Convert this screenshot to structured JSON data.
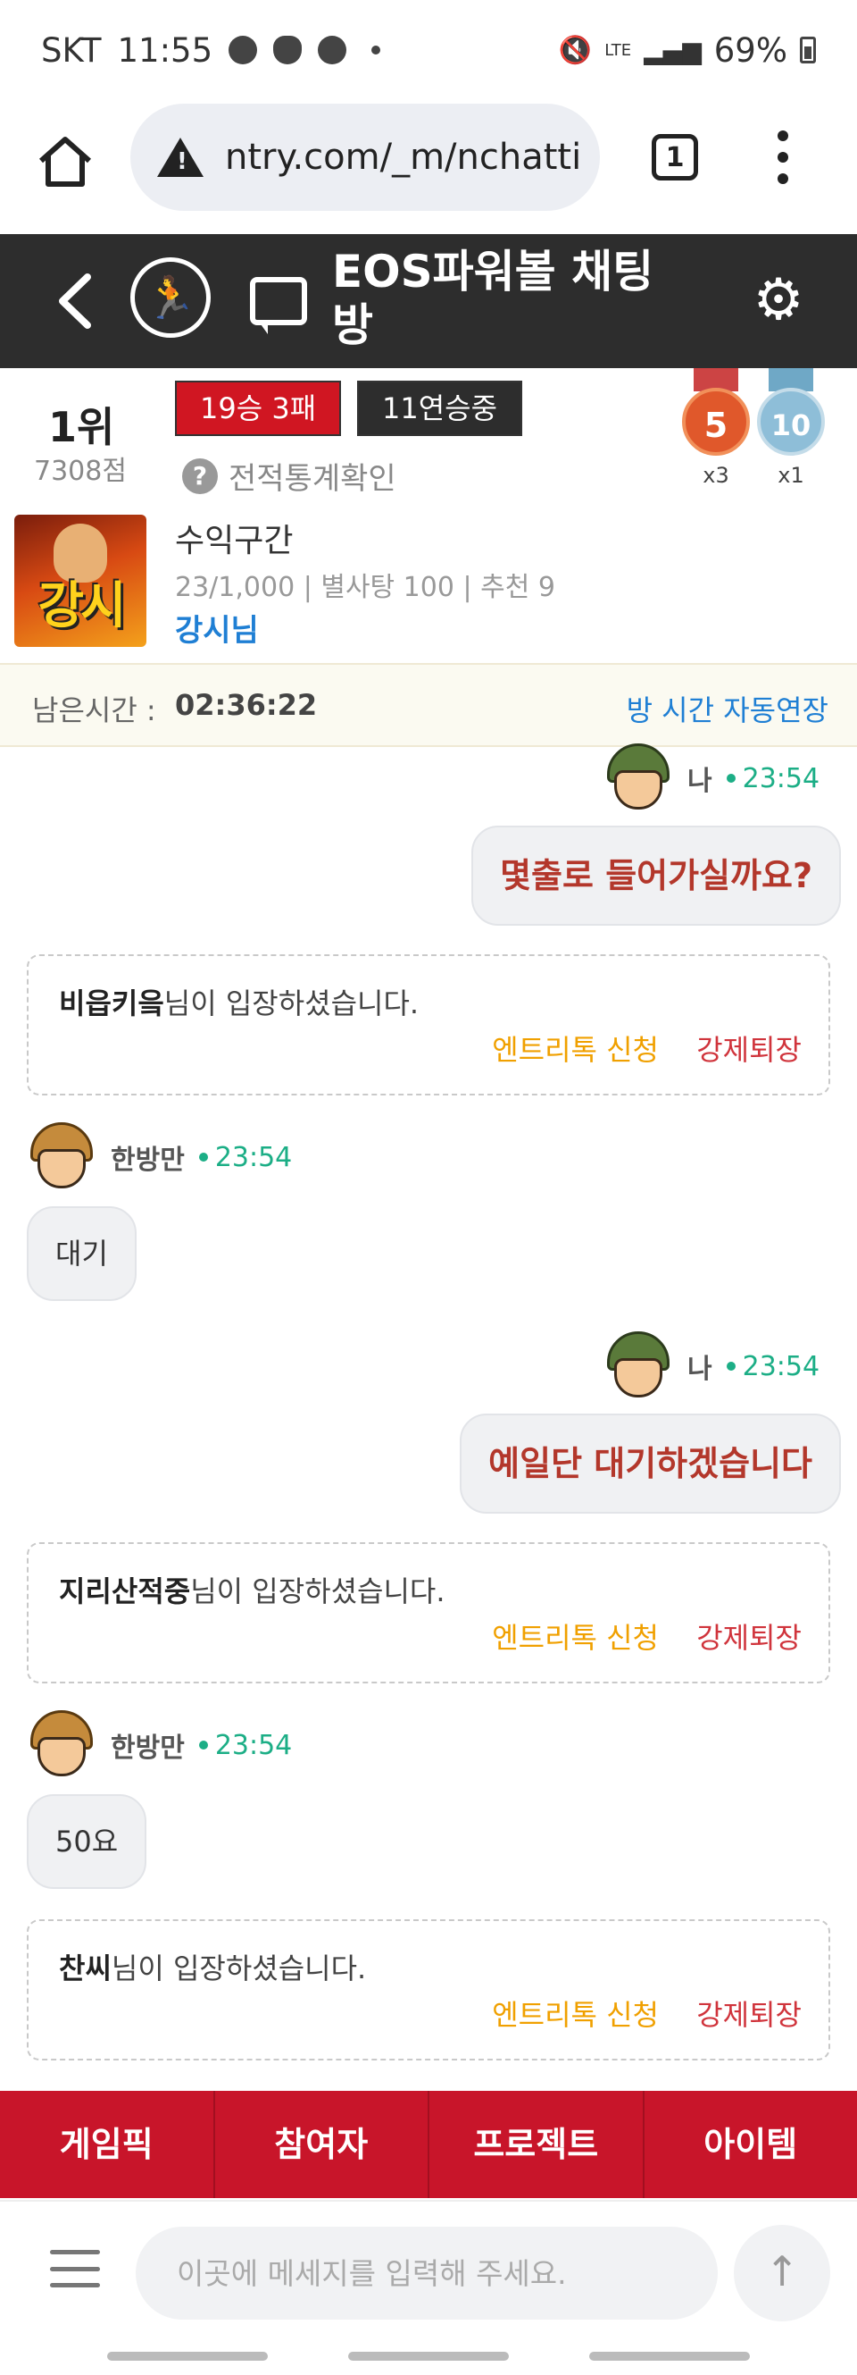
{
  "status_bar": {
    "carrier": "SKT",
    "time": "11:55",
    "lte": "LTE",
    "battery": "69%"
  },
  "browser": {
    "url": "ntry.com/_m/nchatti",
    "tab_count": "1"
  },
  "app_bar": {
    "title": "EOS파워볼 채팅방"
  },
  "rank": {
    "position": "1위",
    "points": "7308점",
    "record": "19승 3패",
    "streak": "11연승중",
    "stats_link": "전적통계확인",
    "medals": [
      {
        "level": "5",
        "count": "x3"
      },
      {
        "level": "10",
        "count": "x1"
      }
    ]
  },
  "room": {
    "avatar_text": "강시",
    "name": "수익구간",
    "meta": "23/1,000 | 별사탕 100 | 추천 9",
    "host": "강시님"
  },
  "timer": {
    "label": "남은시간 :",
    "value": "02:36:22",
    "extend": "방 시간 자동연장"
  },
  "messages": [
    {
      "type": "mine",
      "name": "나",
      "time": "23:54",
      "text": "몇출로 들어가실까요?"
    },
    {
      "type": "notice",
      "user": "비읍키읔",
      "suffix": "님이 입장하셨습니다.",
      "entry": "엔트리톡 신청",
      "kick": "강제퇴장"
    },
    {
      "type": "other",
      "name": "한방만",
      "time": "23:54",
      "text": "대기"
    },
    {
      "type": "mine",
      "name": "나",
      "time": "23:54",
      "text": "예일단 대기하겠습니다"
    },
    {
      "type": "notice",
      "user": "지리산적중",
      "suffix": "님이 입장하셨습니다.",
      "entry": "엔트리톡 신청",
      "kick": "강제퇴장"
    },
    {
      "type": "other",
      "name": "한방만",
      "time": "23:54",
      "text": "50요"
    },
    {
      "type": "notice",
      "user": "찬씨",
      "suffix": "님이 입장하셨습니다.",
      "entry": "엔트리톡 신청",
      "kick": "강제퇴장"
    }
  ],
  "bottom_tabs": [
    "게임픽",
    "참여자",
    "프로젝트",
    "아이템"
  ],
  "input": {
    "placeholder": "이곳에 메세지를 입력해 주세요."
  },
  "colors": {
    "appbar": "#2d2d2d",
    "tabbar": "#c8152a",
    "time_green": "#1cae86",
    "host_blue": "#1f7fd4",
    "entry_orange": "#f0a000",
    "kick_red": "#d0343c"
  }
}
